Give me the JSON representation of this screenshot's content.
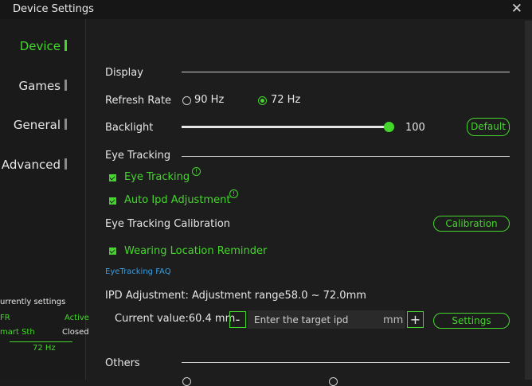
{
  "window": {
    "title": "Device Settings"
  },
  "icons": {
    "close": "close-icon",
    "info": "info-icon",
    "check": "check-icon"
  },
  "colors": {
    "accent": "#44d62c",
    "link": "#3a9de0",
    "background": "#1d1d1d"
  },
  "sidebar": {
    "items": [
      {
        "label": "Device",
        "active": true
      },
      {
        "label": "Games",
        "active": false
      },
      {
        "label": "General",
        "active": false
      },
      {
        "label": "Advanced",
        "active": false
      }
    ],
    "status": {
      "heading": "urrently settings",
      "rows": [
        {
          "name": "FR",
          "value": "Active"
        },
        {
          "name": "mart Sth",
          "value": "Closed"
        }
      ],
      "footer": "72 Hz"
    }
  },
  "display": {
    "section": "Display",
    "refresh_rate_label": "Refresh Rate",
    "refresh_options": [
      {
        "label": "90 Hz",
        "selected": false
      },
      {
        "label": "72 Hz",
        "selected": true
      }
    ],
    "backlight_label": "Backlight",
    "backlight_value": "100",
    "backlight_level": 1.0,
    "default_button": "Default"
  },
  "eye_tracking": {
    "section": "Eye Tracking",
    "eye_tracking_label": "Eye Tracking",
    "eye_tracking_checked": true,
    "auto_ipd_label": "Auto Ipd Adjustment",
    "auto_ipd_checked": true,
    "calibration_label": "Eye Tracking Calibration",
    "calibration_button": "Calibration",
    "wearing_reminder_label": "Wearing Location Reminder",
    "wearing_reminder_checked": true,
    "faq_link": "EyeTracking FAQ",
    "ipd_label": "IPD Adjustment: Adjustment range58.0 ~ 72.0mm",
    "current_value_label": "Current value:60.4 mm",
    "minus_button": "-",
    "plus_button": "+",
    "ipd_placeholder": "Enter the target ipd",
    "ipd_unit": "mm",
    "settings_button": "Settings"
  },
  "others": {
    "section": "Others"
  }
}
